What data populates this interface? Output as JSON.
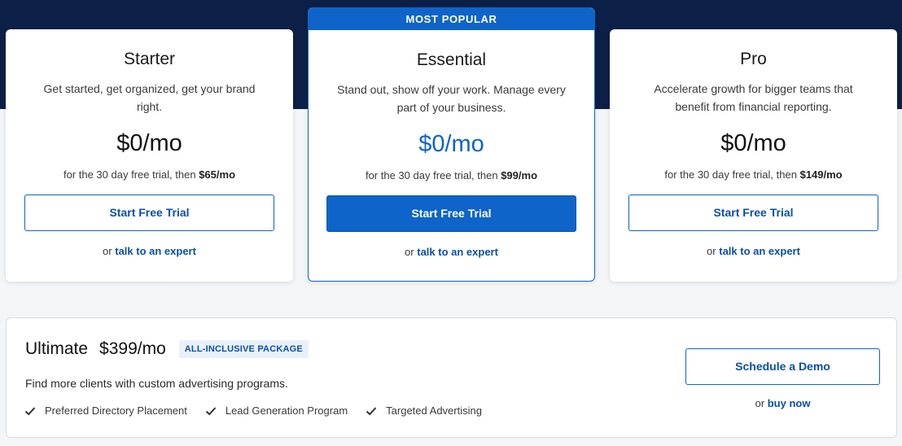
{
  "plans": [
    {
      "name": "Starter",
      "description": "Get started, get organized, get your brand right.",
      "price": "$0/mo",
      "trial_prefix": "for the 30 day free trial, then",
      "trial_price": "$65/mo",
      "button_label": "Start Free Trial",
      "expert_prefix": "or",
      "expert_link": "talk to an expert"
    },
    {
      "badge": "MOST POPULAR",
      "name": "Essential",
      "description": "Stand out, show off your work. Manage every part of your business.",
      "price": "$0/mo",
      "trial_prefix": "for the 30 day free trial, then",
      "trial_price": "$99/mo",
      "button_label": "Start Free Trial",
      "expert_prefix": "or",
      "expert_link": "talk to an expert"
    },
    {
      "name": "Pro",
      "description": "Accelerate growth for bigger teams that benefit from financial reporting.",
      "price": "$0/mo",
      "trial_prefix": "for the 30 day free trial, then",
      "trial_price": "$149/mo",
      "button_label": "Start Free Trial",
      "expert_prefix": "or",
      "expert_link": "talk to an expert"
    }
  ],
  "ultimate": {
    "name": "Ultimate",
    "price": "$399/mo",
    "badge": "ALL-INCLUSIVE PACKAGE",
    "description": "Find more clients with custom advertising programs.",
    "features": [
      "Preferred Directory Placement",
      "Lead Generation Program",
      "Targeted Advertising"
    ],
    "feature_icon": "check-icon",
    "demo_button_label": "Schedule a Demo",
    "buy_prefix": "or",
    "buy_link": "buy now"
  },
  "colors": {
    "hero_band": "#0c1f47",
    "accent": "#0e64c8",
    "link": "#0b4fa6"
  }
}
